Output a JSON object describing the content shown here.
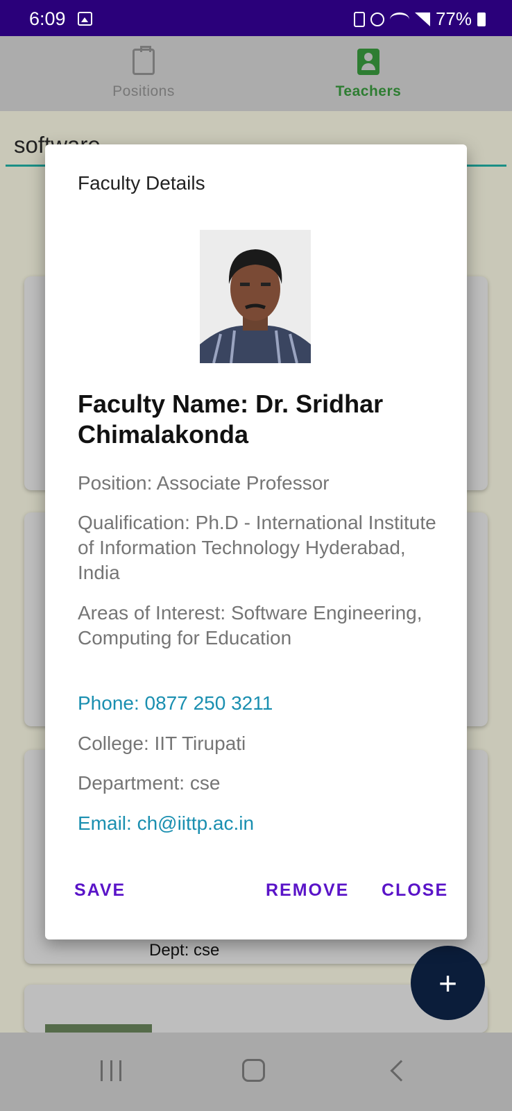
{
  "status_bar": {
    "time": "6:09",
    "battery": "77%"
  },
  "tabs": [
    {
      "label": "Positions",
      "icon": "clipboard-search-icon",
      "selected": false
    },
    {
      "label": "Teachers",
      "icon": "clipboard-account-icon",
      "selected": true
    }
  ],
  "search": {
    "value": "software"
  },
  "background_card": {
    "dept": "Dept: cse"
  },
  "dialog": {
    "title": "Faculty Details",
    "faculty_name": "Faculty Name: Dr. Sridhar Chimalakonda",
    "position": "Position: Associate Professor",
    "qualification": "Qualification: Ph.D - International Institute of Information Technology Hyderabad, India",
    "areas": "Areas of Interest: Software Engineering, Computing for Education",
    "phone": "Phone: 0877 250 3211",
    "college": "College: IIT Tirupati",
    "department": "Department: cse",
    "email": "Email: ch@iittp.ac.in",
    "buttons": {
      "save": "SAVE",
      "remove": "REMOVE",
      "close": "CLOSE"
    }
  },
  "fab": {
    "label": "+"
  },
  "colors": {
    "status_bar": "#2a007a",
    "teachers_tab": "#2e7d32",
    "link": "#1a8fb0",
    "dialog_button": "#5a14c8",
    "fab": "#0b1d3a"
  }
}
